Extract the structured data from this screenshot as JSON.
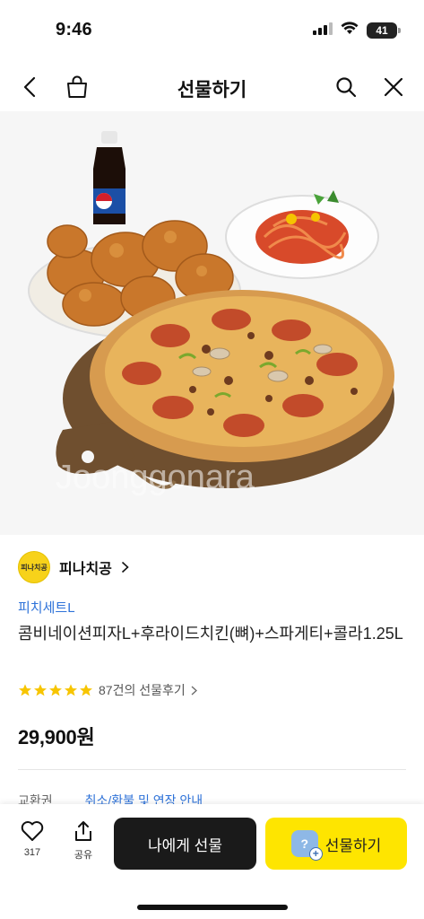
{
  "status_bar": {
    "time": "9:46",
    "battery": "41"
  },
  "nav": {
    "title": "선물하기"
  },
  "hero": {
    "watermark": "Joonggonara"
  },
  "product": {
    "brand": "피나치공",
    "brand_logo_text": "피나치공",
    "category": "피치세트L",
    "title": "콤비네이션피자L+후라이드치킨(뼈)+스파게티+콜라1.25L",
    "rating_stars": 5,
    "review_text": "87건의 선물후기",
    "price": "29,900원"
  },
  "exchange": {
    "label": "교환권",
    "link_text": "취소/환불 및 연장 안내"
  },
  "bottom": {
    "like_count": "317",
    "share_label": "공유",
    "self_button": "나에게 선물",
    "gift_button": "선물하기"
  },
  "colors": {
    "accent_yellow": "#fee500",
    "link_blue": "#2f73d9",
    "star_yellow": "#f7c500"
  }
}
